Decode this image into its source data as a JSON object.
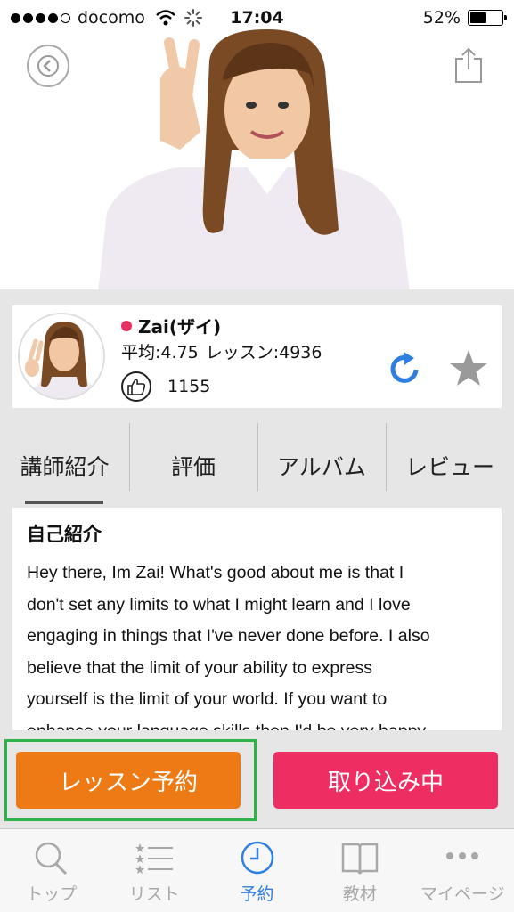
{
  "status_bar": {
    "carrier": "docomo",
    "time": "17:04",
    "battery_percent": "52%",
    "battery_level": 0.52,
    "signal_bars_filled": 4,
    "signal_bars_total": 5
  },
  "hero": {
    "back_icon": "chevron-left-circle-icon",
    "share_icon": "share-icon"
  },
  "teacher": {
    "name": "Zai(ザイ)",
    "online_color": "#e9315f",
    "average": "平均:4.75",
    "lessons": "レッスン:4936",
    "likes": "1155"
  },
  "tabs": [
    {
      "label": "講師紹介",
      "active": true
    },
    {
      "label": "評価",
      "active": false
    },
    {
      "label": "アルバム",
      "active": false
    },
    {
      "label": "レビュー",
      "active": false
    }
  ],
  "intro": {
    "title": "自己紹介",
    "lines": [
      "Hey there, Im Zai! What's good about me is that I",
      "don't set any limits to what I might learn and I love",
      "engaging in things that I've never done before. I also",
      "believe that the limit of your ability to express",
      "yourself is the limit of your world. If you want to",
      "enhance your language skills then I'd be very happy"
    ]
  },
  "actions": {
    "book_label": "レッスン予約",
    "import_label": "取り込み中",
    "book_color": "#ed7a14",
    "import_color": "#ee2e62",
    "highlight_color": "#2db34a"
  },
  "tabbar": [
    {
      "label": "トップ",
      "icon": "search-icon",
      "active": false
    },
    {
      "label": "リスト",
      "icon": "star-list-icon",
      "active": false
    },
    {
      "label": "予約",
      "icon": "clock-icon",
      "active": true
    },
    {
      "label": "教材",
      "icon": "book-icon",
      "active": false
    },
    {
      "label": "マイページ",
      "icon": "more-dots-icon",
      "active": false
    }
  ],
  "accent_color": "#2f7fe0"
}
